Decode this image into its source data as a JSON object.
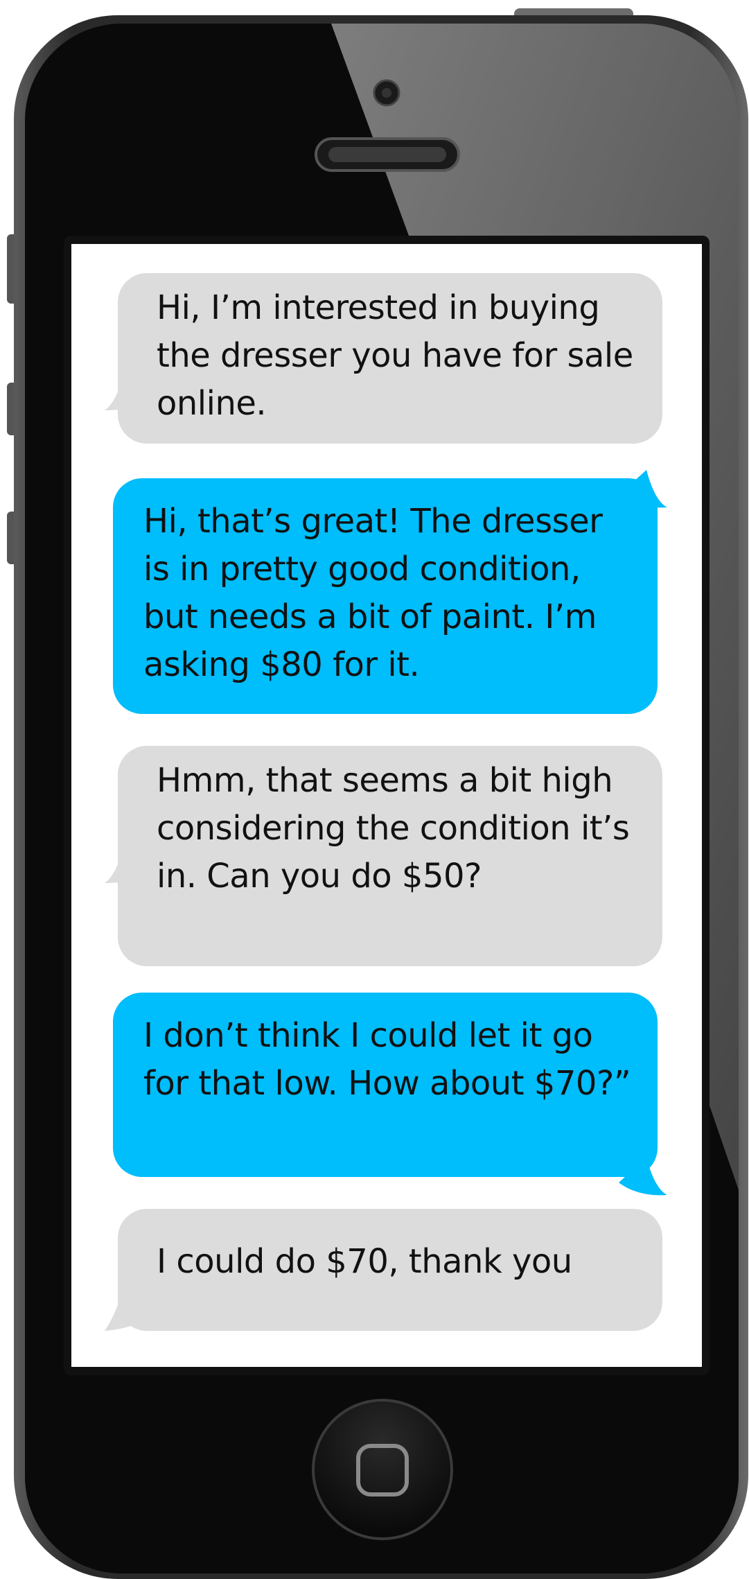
{
  "colors": {
    "received_bubble": "#dcdcdc",
    "sent_bubble": "#00bdfc",
    "phone_body": "#1c1c1c",
    "screen": "#ffffff"
  },
  "device": {
    "home_button_icon": "rounded-square-icon",
    "camera_icon": "front-camera-icon",
    "speaker_icon": "earpiece-speaker-icon"
  },
  "messages": [
    {
      "sender": "received",
      "text": "Hi, I’m interested in buying the dresser you have for sale online."
    },
    {
      "sender": "sent",
      "text": "Hi, that’s great! The dresser is in pretty good condition, but needs a bit of paint. I’m asking $80 for it."
    },
    {
      "sender": "received",
      "text": "Hmm, that seems a bit high considering the condition it’s in. Can you do $50?"
    },
    {
      "sender": "sent",
      "text": "I don’t think I could let it go for that low. How about $70?”"
    },
    {
      "sender": "received",
      "text": "I could do $70, thank you"
    }
  ]
}
